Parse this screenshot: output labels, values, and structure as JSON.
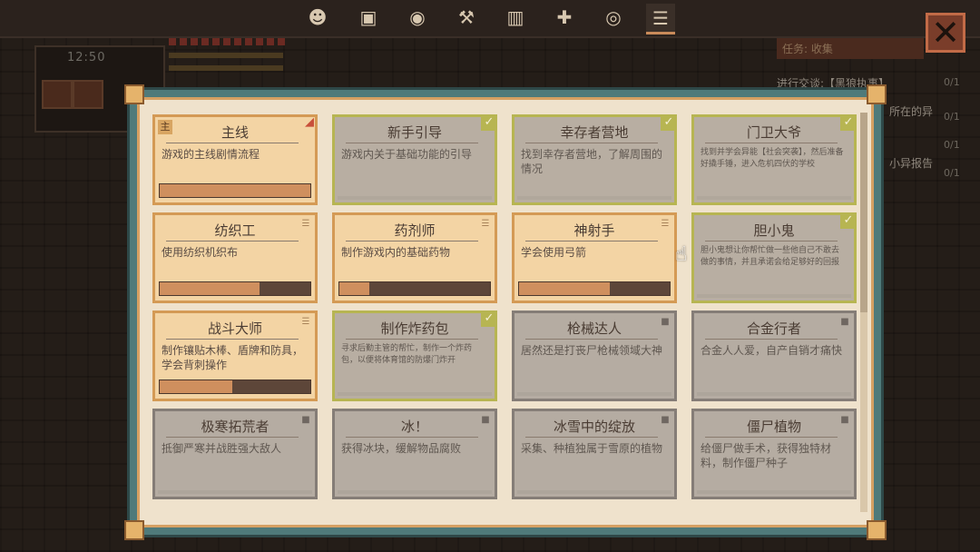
{
  "hud": {
    "clock": "12:50"
  },
  "side_quest": {
    "tag": "任务: 收集",
    "lines": [
      "进行交谈:【黑狼执事】",
      "所在的异",
      "小异报告"
    ],
    "counts": [
      "0/1",
      "0/1",
      "0/1",
      "0/1"
    ]
  },
  "toolbar": {
    "icons": [
      "character-icon",
      "backpack-icon",
      "skill-orb-icon",
      "crafting-icon",
      "map-icon",
      "add-friend-icon",
      "coin-icon",
      "quest-list-icon"
    ],
    "active": "quest-list-icon",
    "close_label": "✕"
  },
  "quests": [
    {
      "title": "主线",
      "desc": "游戏的主线剧情流程",
      "state": "gold",
      "progress": 1.0,
      "main_tag": "主",
      "flag": true
    },
    {
      "title": "新手引导",
      "desc": "游戏内关于基础功能的引导",
      "state": "done"
    },
    {
      "title": "幸存者营地",
      "desc": "找到幸存者营地，了解周围的情况",
      "state": "done"
    },
    {
      "title": "门卫大爷",
      "desc": "找到并学会异能【社会突袭】，然后准备好撬手锤，进入危机四伏的学校",
      "state": "done",
      "small": true
    },
    {
      "title": "纺织工",
      "desc": "使用纺织机织布",
      "state": "gold",
      "progress": 0.66
    },
    {
      "title": "药剂师",
      "desc": "制作游戏内的基础药物",
      "state": "gold",
      "progress": 0.2
    },
    {
      "title": "神射手",
      "desc": "学会使用弓箭",
      "state": "gold",
      "progress": 0.6
    },
    {
      "title": "胆小鬼",
      "desc": "胆小鬼想让你帮忙做一些他自己不敢去做的事情，并且承诺会给足够好的回报",
      "state": "done",
      "small": true
    },
    {
      "title": "战斗大师",
      "desc": "制作镶贴木棒、盾牌和防具，学会背刺操作",
      "state": "gold",
      "progress": 0.48
    },
    {
      "title": "制作炸药包",
      "desc": "寻求后勤主管的帮忙，制作一个炸药包，以便将体育馆的防爆门炸开",
      "state": "done",
      "small": true
    },
    {
      "title": "枪械达人",
      "desc": "居然还是打丧尸枪械领域大神",
      "state": "locked"
    },
    {
      "title": "合金行者",
      "desc": "合金人人爱，自产自销才痛快",
      "state": "locked"
    },
    {
      "title": "极寒拓荒者",
      "desc": "抵御严寒并战胜强大敌人",
      "state": "locked"
    },
    {
      "title": "冰！",
      "desc": "获得冰块，缓解物品腐败",
      "state": "locked"
    },
    {
      "title": "冰雪中的绽放",
      "desc": "采集、种植独属于雪原的植物",
      "state": "locked"
    },
    {
      "title": "僵尸植物",
      "desc": "给僵尸做手术，获得独特材料，制作僵尸种子",
      "state": "locked"
    }
  ]
}
